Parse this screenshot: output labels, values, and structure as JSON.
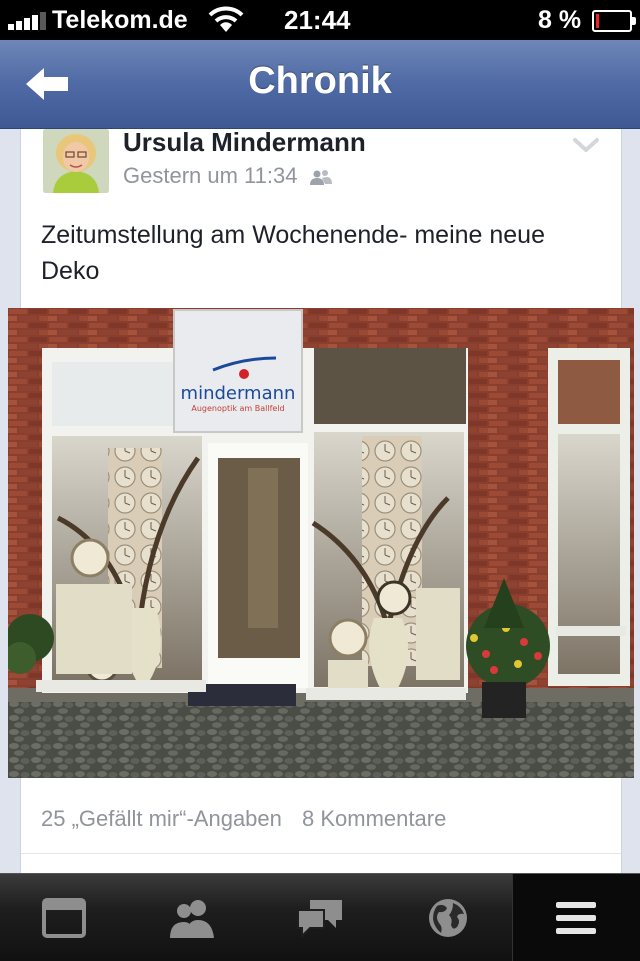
{
  "status_bar": {
    "carrier": "Telekom.de",
    "time": "21:44",
    "battery": "8 %",
    "battery_level": 0.08,
    "battery_color": "#e8262a"
  },
  "navbar": {
    "title": "Chronik",
    "back_icon": "back-arrow-icon",
    "background_color": "#4f6aa4"
  },
  "post": {
    "author": "Ursula Mindermann",
    "timestamp": "Gestern um 11:34",
    "privacy_icon": "friends-icon",
    "text": "Zeitumstellung am Wochenende- meine neue Deko",
    "photo": {
      "sign_brand": "mindermann",
      "sign_tagline": "Augenoptik am Ballfeld"
    },
    "likes": "25 „Gefällt mir“-Angaben",
    "comments": "8 Kommentare"
  },
  "tab_bar": {
    "tabs": [
      {
        "icon": "news-feed-icon",
        "active": false
      },
      {
        "icon": "friend-requests-icon",
        "active": false
      },
      {
        "icon": "messages-icon",
        "active": false
      },
      {
        "icon": "notifications-globe-icon",
        "active": false
      },
      {
        "icon": "menu-icon",
        "active": true
      }
    ]
  }
}
